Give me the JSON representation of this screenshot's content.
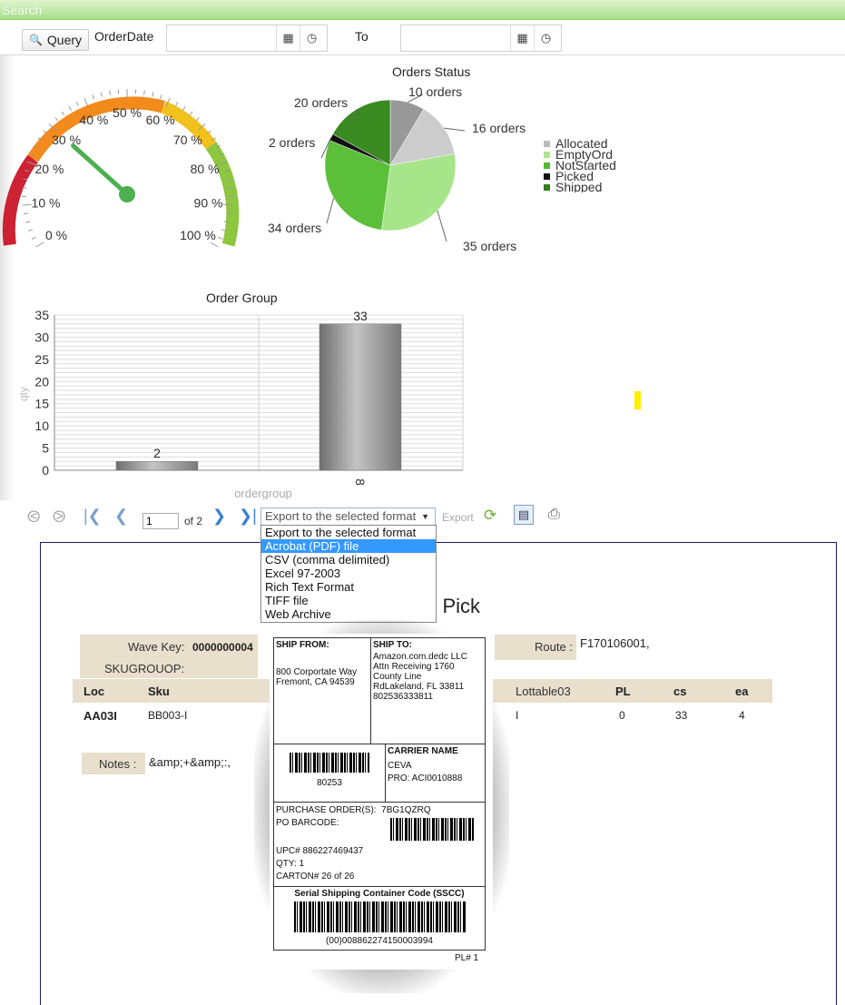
{
  "search": {
    "header_label": "Search",
    "query_button": "Query",
    "order_date_label": "OrderDate",
    "to_label": "To",
    "date_from_value": "",
    "date_to_value": ""
  },
  "gauge": {
    "ticks": [
      "0 %",
      "10 %",
      "20 %",
      "30 %",
      "40 %",
      "50 %",
      "60 %",
      "70 %",
      "80 %",
      "90 %",
      "100 %"
    ],
    "value_percent": 30
  },
  "chart_data": [
    {
      "type": "pie",
      "title": "Orders Status",
      "labels": [
        "10 orders",
        "16 orders",
        "35 orders",
        "34 orders",
        "2 orders",
        "20 orders"
      ],
      "values": [
        10,
        16,
        35,
        34,
        2,
        20
      ],
      "slice_colors": [
        "#999999",
        "#cccccc",
        "#a6e58a",
        "#5cbf3a",
        "#111111",
        "#3a8a22"
      ],
      "legend": [
        "Allocated",
        "EmptyOrd",
        "NotStarted",
        "Picked",
        "Shipped"
      ],
      "legend_colors": [
        "#bbbbbb",
        "#aee58f",
        "#55bb33",
        "#111111",
        "#2f7d1c"
      ],
      "legend_position": "right"
    },
    {
      "type": "bar",
      "title": "Order Group",
      "categories": [
        "",
        "8"
      ],
      "values": [
        2,
        33
      ],
      "data_labels": [
        "2",
        "33"
      ],
      "xlabel": "ordergroup",
      "ylabel": "qty",
      "ylim": [
        0,
        35
      ],
      "yticks": [
        0,
        5,
        10,
        15,
        20,
        25,
        30,
        35
      ],
      "grid": true
    }
  ],
  "toolbar": {
    "page_value": "1",
    "page_of": "of 2",
    "export_selected": "Export to the selected format",
    "export_button": "Export",
    "export_options": [
      "Export to the selected format",
      "Acrobat (PDF) file",
      "CSV (comma delimited)",
      "Excel 97-2003",
      "Rich Text Format",
      "TIFF file",
      "Web Archive"
    ],
    "highlighted_option_index": 1
  },
  "report": {
    "title_fragment": "m Pick",
    "wave_key_label": "Wave Key:",
    "wave_key_value": "0000000004",
    "skugroup_label": "SKUGROUOP:",
    "route_label": "Route :",
    "route_value": "F170106001,",
    "columns": [
      "Loc",
      "Sku",
      "Lottable03",
      "PL",
      "cs",
      "ea"
    ],
    "row": {
      "loc": "AA03I",
      "sku": "BB003-I",
      "lottable03": "I",
      "pl": "0",
      "cs": "33",
      "ea": "4"
    },
    "notes_label": "Notes :",
    "notes_value": "&amp;+&amp;:,"
  },
  "shipping_label": {
    "ship_from_title": "SHIP FROM:",
    "ship_from_lines": [
      "800 Corportate Way",
      "Fremont, CA 94539"
    ],
    "ship_to_title": "SHIP TO:",
    "ship_to_lines": [
      "Amazon.com.dedc LLC",
      "Attn Receiving 1760",
      "County Line",
      "RdLakeland, FL 33811",
      "802536333811"
    ],
    "barcode_number": "80253",
    "carrier_title": "CARRIER NAME",
    "carrier_name": "CEVA",
    "pro_line": "PRO:  ACI0010888",
    "purchase_orders_label": "PURCHASE ORDER(S):",
    "purchase_orders_value": "7BG1QZRQ",
    "po_barcode_label": "PO BARCODE:",
    "upc_line": "UPC#    886227469437",
    "qty_line": "QTY:    1",
    "carton_line": "CARTON#    26 of 26",
    "sscc_title": "Serial Shipping Container Code (SSCC)",
    "sscc_value": "(00)008862274150003994",
    "pl_line": "PL# 1"
  }
}
